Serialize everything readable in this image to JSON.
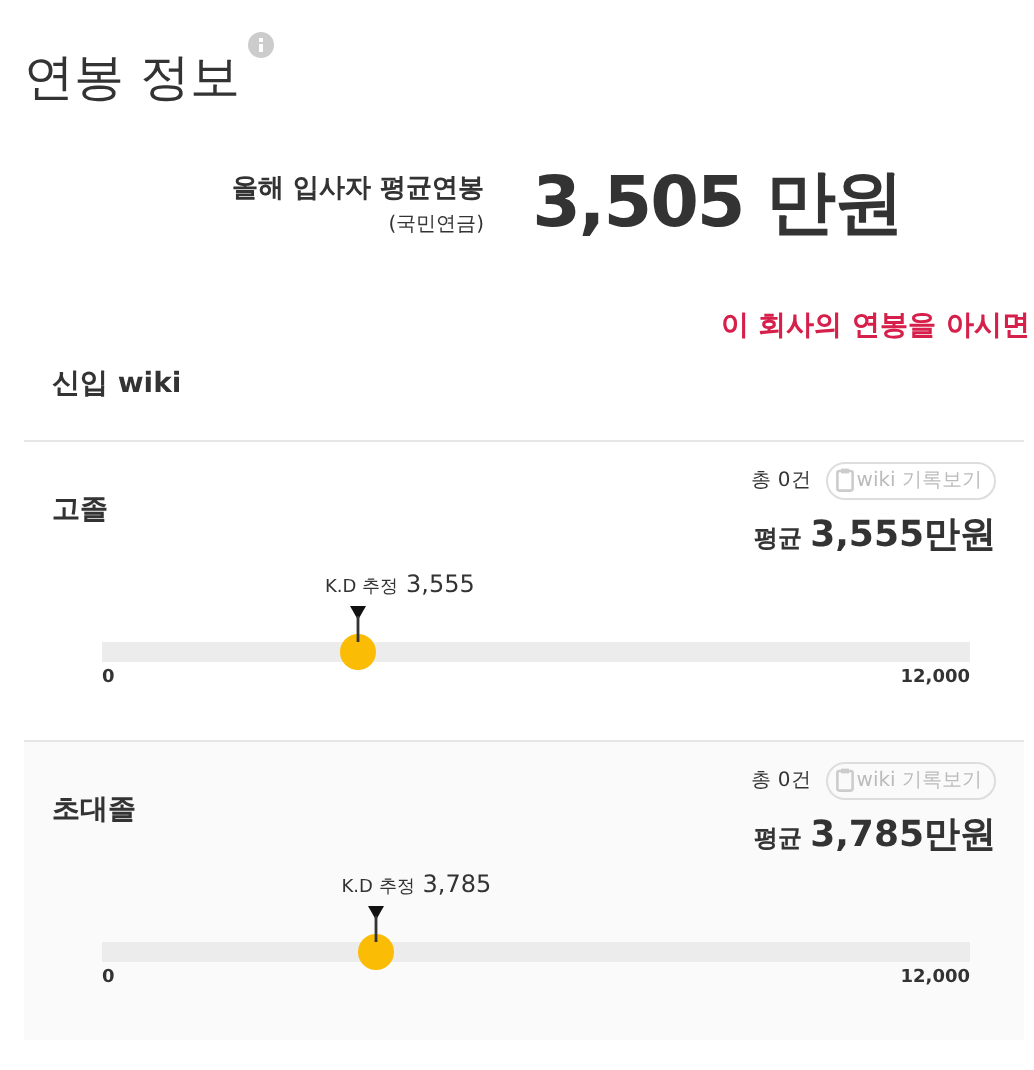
{
  "title": "연봉 정보",
  "average": {
    "label": "올해 입사자 평균연봉",
    "sublabel": "(국민연금)",
    "value": "3,505 만원"
  },
  "prompt_link": "이 회사의 연봉을 아시면",
  "wiki_title": "신입 wiki",
  "groups": [
    {
      "name": "고졸",
      "count": "총 0건",
      "button": "wiki 기록보기",
      "avg_label": "평균",
      "avg_value": "3,555만원",
      "marker_label": "K.D 추정",
      "marker_value": "3,555",
      "level": 0.296,
      "min": "0",
      "max": "12,000"
    },
    {
      "name": "초대졸",
      "count": "총 0건",
      "button": "wiki 기록보기",
      "avg_label": "평균",
      "avg_value": "3,785만원",
      "marker_label": "K.D 추정",
      "marker_value": "3,785",
      "level": 0.315,
      "min": "0",
      "max": "12,000"
    }
  ]
}
